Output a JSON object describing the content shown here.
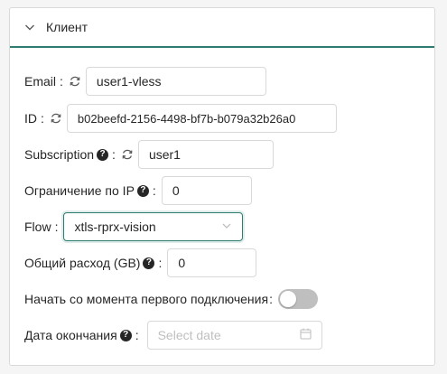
{
  "panel": {
    "title": "Клиент",
    "icons": {
      "collapse": "chevron-down-icon"
    }
  },
  "form": {
    "email": {
      "label": "Email",
      "colon": ":",
      "value": "user1-vless",
      "icon": "sync-icon"
    },
    "id": {
      "label": "ID",
      "colon": ":",
      "value": "b02beefd-2156-4498-bf7b-b079a32b26a0",
      "icon": "sync-icon"
    },
    "subscription": {
      "label": "Subscription",
      "colon": ":",
      "value": "user1",
      "help": "?",
      "icon": "sync-icon"
    },
    "ip_limit": {
      "label": "Ограничение по IP",
      "colon": ":",
      "value": "0",
      "help": "?"
    },
    "flow": {
      "label": "Flow",
      "colon": ":",
      "value": "xtls-rprx-vision",
      "icon": "chevron-down-icon"
    },
    "total_gb": {
      "label": "Общий расход (GB)",
      "colon": ":",
      "value": "0",
      "help": "?"
    },
    "start_on_first_use": {
      "label": "Начать со момента первого подключения",
      "colon": ":",
      "enabled": false
    },
    "expiry": {
      "label": "Дата окончания",
      "colon": ":",
      "placeholder": "Select date",
      "help": "?",
      "icon": "calendar-icon"
    }
  },
  "colors": {
    "accent": "#2f7d72",
    "border": "#d9d9d9",
    "switch_off": "#bfbfbf",
    "placeholder": "#bfbfbf"
  }
}
